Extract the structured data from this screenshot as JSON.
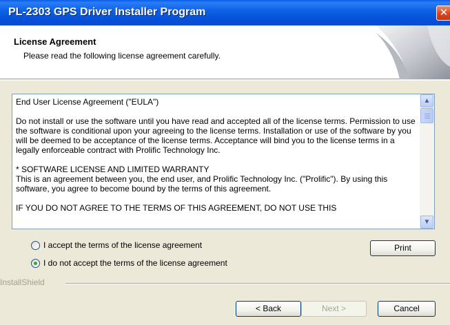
{
  "window": {
    "title": "PL-2303 GPS Driver Installer Program",
    "close_glyph": "✕"
  },
  "header": {
    "title": "License Agreement",
    "subtitle": "Please read the following license agreement carefully."
  },
  "eula": {
    "text": "End User License Agreement (\"EULA\")\n\nDo not install or use the software until you have read and accepted all of the license terms. Permission to use the software is conditional upon your agreeing to the license terms. Installation or use of the software by you will be deemed to be acceptance of the license terms. Acceptance will bind you to the license terms in a legally enforceable contract with Prolific Technology Inc.\n\n* SOFTWARE LICENSE AND LIMITED WARRANTY\nThis is an agreement between you, the end user, and Prolific Technology Inc. (\"Prolific\"). By using this software, you agree to become bound by the terms of this agreement.\n\nIF YOU DO NOT AGREE TO THE TERMS OF THIS AGREEMENT, DO NOT USE THIS"
  },
  "scrollbar": {
    "up_glyph": "▲",
    "down_glyph": "▼"
  },
  "options": {
    "accept_label": "I accept the terms of the license agreement",
    "decline_label": "I do not accept the terms of the license agreement",
    "selected": "decline"
  },
  "buttons": {
    "print": "Print",
    "back": "< Back",
    "next": "Next >",
    "cancel": "Cancel"
  },
  "footer": {
    "brand": "InstallShield"
  }
}
